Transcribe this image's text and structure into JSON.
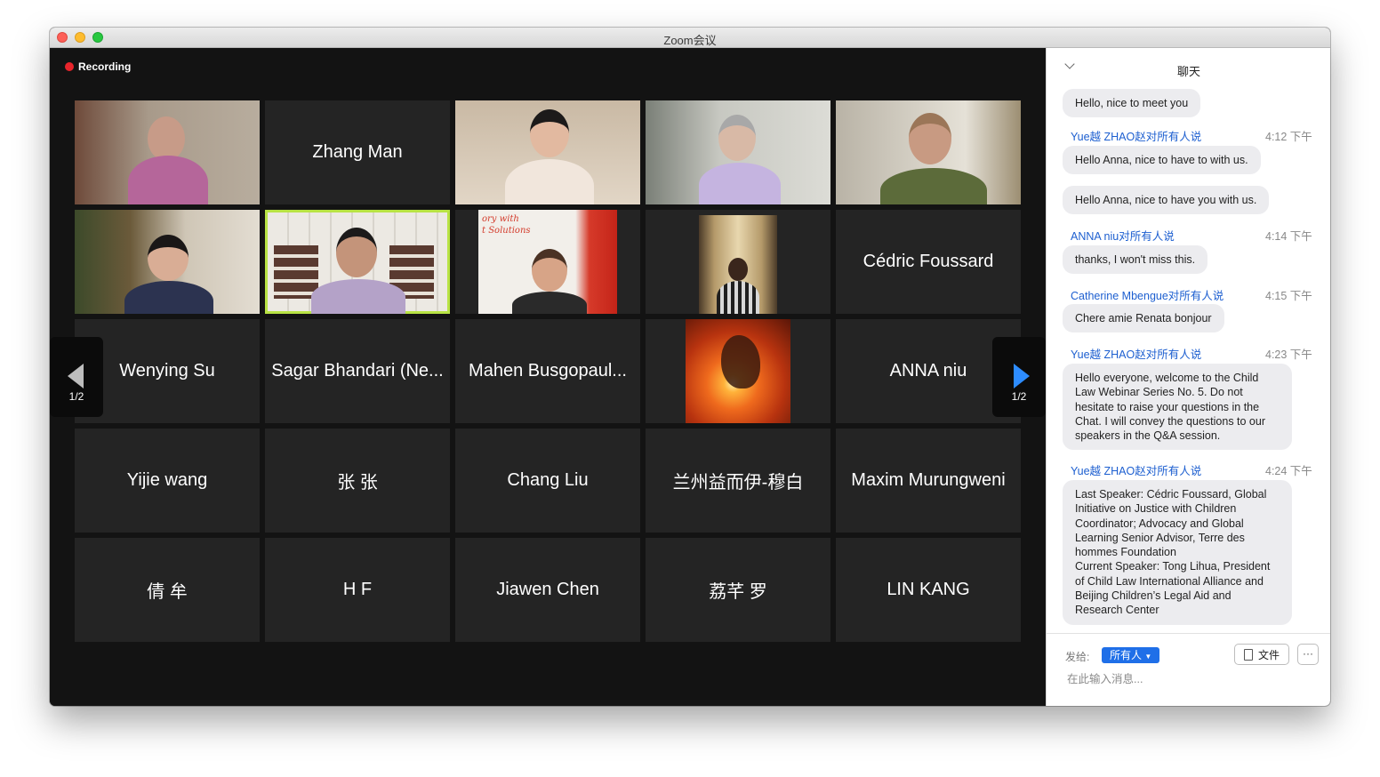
{
  "window": {
    "title": "Zoom会议"
  },
  "recording": {
    "label": "Recording"
  },
  "pager": {
    "left_label": "1/2",
    "right_label": "1/2"
  },
  "tiles": {
    "r1c2": "Zhang Man",
    "r2c5": "Cédric Foussard",
    "r3c1": "Wenying Su",
    "r3c2": "Sagar Bhandari (Ne...",
    "r3c3": "Mahen Busgopaul...",
    "r3c5": "ANNA niu",
    "r4c1": "Yijie wang",
    "r4c2": "张 张",
    "r4c3": "Chang Liu",
    "r4c4": "兰州益而伊-穆白",
    "r4c5": "Maxim Murungweni",
    "r5c1": "倩 牟",
    "r5c2": "H F",
    "r5c3": "Jiawen Chen",
    "r5c4": "荔芊 罗",
    "r5c5": "LIN KANG"
  },
  "video_text": {
    "poster_text": "ory with\nt Solutions"
  },
  "chat": {
    "title": "聊天",
    "messages": [
      {
        "text": "Hello, nice to meet you"
      },
      {
        "sender": "Yue越 ZHAO赵对所有人说",
        "time": "4:12 下午",
        "text": "Hello Anna, nice to have to with us."
      },
      {
        "text": "Hello Anna, nice to have you with us."
      },
      {
        "sender": "ANNA niu对所有人说",
        "time": "4:14 下午",
        "text": "thanks, I won't miss this."
      },
      {
        "sender": "Catherine Mbengue对所有人说",
        "time": "4:15 下午",
        "text": "Chere amie Renata bonjour"
      },
      {
        "sender": "Yue越 ZHAO赵对所有人说",
        "time": "4:23 下午",
        "text": "Hello everyone, welcome to the Child Law Webinar Series No. 5. Do not hesitate to raise your questions in the Chat. I will convey the questions to our speakers in the Q&A session."
      },
      {
        "sender": "Yue越 ZHAO赵对所有人说",
        "time": "4:24 下午",
        "text": "Last Speaker: Cédric Foussard, Global Initiative on Justice with Children Coordinator; Advocacy and Global Learning Senior Advisor, Terre des hommes Foundation\nCurrent Speaker: Tong Lihua, President of Child Law International Alliance and Beijing Children’s Legal Aid and Research Center"
      }
    ],
    "send_to_label": "发给:",
    "recipient": "所有人",
    "file_label": "文件",
    "more_label": "···",
    "input_placeholder": "在此输入消息..."
  },
  "colors": {
    "speaking_border": "#b8e344",
    "accent": "#2d8cff",
    "recording": "#e8242b",
    "sender": "#1d5fd0"
  },
  "icons": [
    "close-button",
    "minimize-button",
    "maximize-button",
    "recording-dot",
    "prev-page-arrow",
    "next-page-arrow",
    "chevron-down-icon",
    "file-icon",
    "more-icon",
    "dropdown-caret-icon"
  ]
}
